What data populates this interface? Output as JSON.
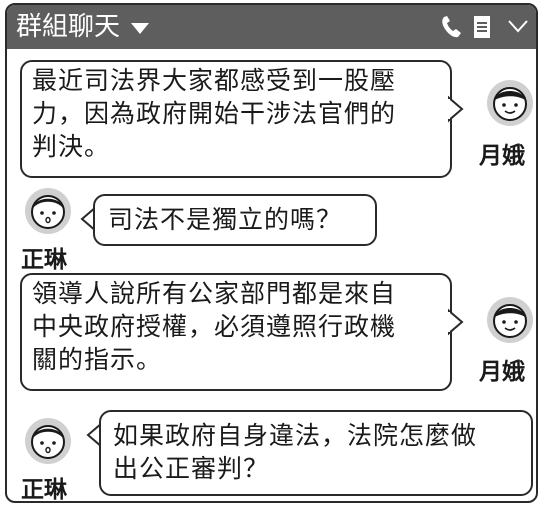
{
  "header": {
    "title": "群組聊天",
    "icons": [
      "caret-down-icon",
      "phone-icon",
      "menu-icon",
      "chevron-down-icon"
    ]
  },
  "messages": [
    {
      "sender": "月娥",
      "side": "right",
      "lines": [
        "最近司法界大家都感受到一股壓",
        "力，因為政府開始干涉法官們的",
        "判決。"
      ]
    },
    {
      "sender": "正琳",
      "side": "left",
      "lines": [
        "司法不是獨立的嗎？"
      ]
    },
    {
      "sender": "月娥",
      "side": "right",
      "lines": [
        "領導人說所有公家部門都是來自",
        "中央政府授權，必須遵照行政機",
        "關的指示。"
      ]
    },
    {
      "sender": "正琳",
      "side": "left",
      "lines": [
        "如果政府自身違法，法院怎麼做",
        "出公正審判？"
      ]
    }
  ],
  "colors": {
    "titlebar": "#5e5e5e",
    "avatar_ring": "#d0d0d0",
    "border": "#2a2a2a"
  }
}
